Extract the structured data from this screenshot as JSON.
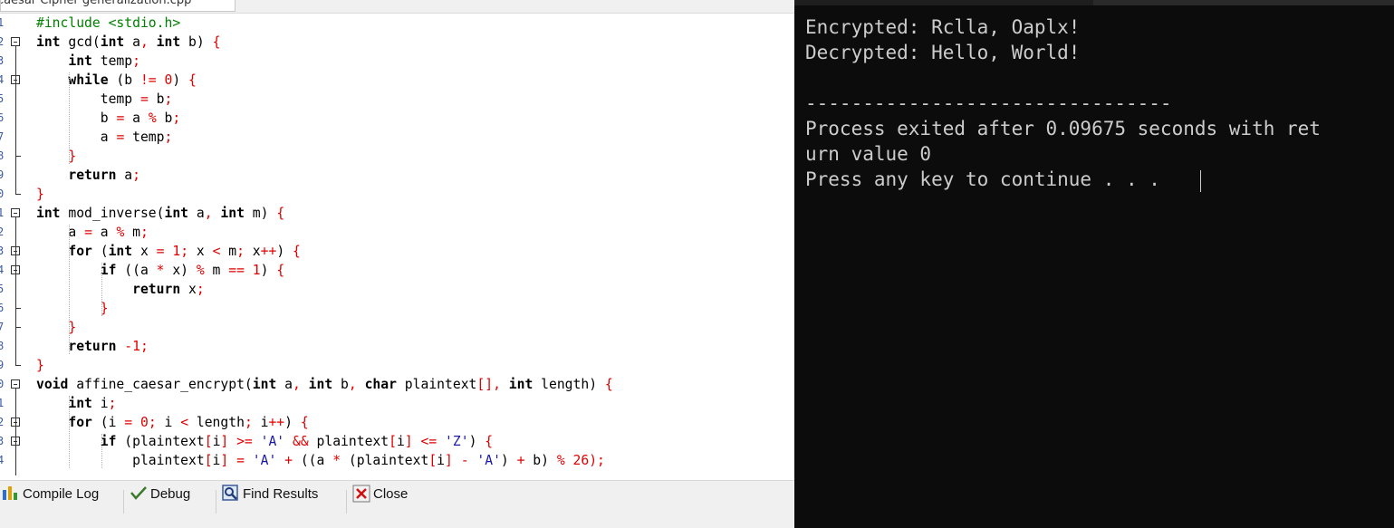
{
  "editor": {
    "tab_title": "Caesar Cipher generalization.cpp",
    "lines": [
      [
        {
          "t": "#include <stdio.h>",
          "c": "pp"
        }
      ],
      [
        {
          "t": "int",
          "c": "kw"
        },
        {
          "t": " gcd("
        },
        {
          "t": "int",
          "c": "kw"
        },
        {
          "t": " a"
        },
        {
          "t": ",",
          "c": "op"
        },
        {
          "t": " "
        },
        {
          "t": "int",
          "c": "kw"
        },
        {
          "t": " b) "
        },
        {
          "t": "{",
          "c": "op"
        }
      ],
      [
        {
          "t": "    "
        },
        {
          "t": "int",
          "c": "kw"
        },
        {
          "t": " temp"
        },
        {
          "t": ";",
          "c": "op"
        }
      ],
      [
        {
          "t": "    "
        },
        {
          "t": "while",
          "c": "kw"
        },
        {
          "t": " (b "
        },
        {
          "t": "!=",
          "c": "op"
        },
        {
          "t": " "
        },
        {
          "t": "0",
          "c": "num"
        },
        {
          "t": ") "
        },
        {
          "t": "{",
          "c": "op"
        }
      ],
      [
        {
          "t": "        temp "
        },
        {
          "t": "=",
          "c": "op"
        },
        {
          "t": " b"
        },
        {
          "t": ";",
          "c": "op"
        }
      ],
      [
        {
          "t": "        b "
        },
        {
          "t": "=",
          "c": "op"
        },
        {
          "t": " a "
        },
        {
          "t": "%",
          "c": "op"
        },
        {
          "t": " b"
        },
        {
          "t": ";",
          "c": "op"
        }
      ],
      [
        {
          "t": "        a "
        },
        {
          "t": "=",
          "c": "op"
        },
        {
          "t": " temp"
        },
        {
          "t": ";",
          "c": "op"
        }
      ],
      [
        {
          "t": "    "
        },
        {
          "t": "}",
          "c": "op"
        }
      ],
      [
        {
          "t": "    "
        },
        {
          "t": "return",
          "c": "kw"
        },
        {
          "t": " a"
        },
        {
          "t": ";",
          "c": "op"
        }
      ],
      [
        {
          "t": "}",
          "c": "op"
        }
      ],
      [
        {
          "t": "int",
          "c": "kw"
        },
        {
          "t": " mod_inverse("
        },
        {
          "t": "int",
          "c": "kw"
        },
        {
          "t": " a"
        },
        {
          "t": ",",
          "c": "op"
        },
        {
          "t": " "
        },
        {
          "t": "int",
          "c": "kw"
        },
        {
          "t": " m) "
        },
        {
          "t": "{",
          "c": "op"
        }
      ],
      [
        {
          "t": "    a "
        },
        {
          "t": "=",
          "c": "op"
        },
        {
          "t": " a "
        },
        {
          "t": "%",
          "c": "op"
        },
        {
          "t": " m"
        },
        {
          "t": ";",
          "c": "op"
        }
      ],
      [
        {
          "t": "    "
        },
        {
          "t": "for",
          "c": "kw"
        },
        {
          "t": " ("
        },
        {
          "t": "int",
          "c": "kw"
        },
        {
          "t": " x "
        },
        {
          "t": "=",
          "c": "op"
        },
        {
          "t": " "
        },
        {
          "t": "1",
          "c": "num"
        },
        {
          "t": ";",
          "c": "op"
        },
        {
          "t": " x "
        },
        {
          "t": "<",
          "c": "op"
        },
        {
          "t": " m"
        },
        {
          "t": ";",
          "c": "op"
        },
        {
          "t": " x"
        },
        {
          "t": "++",
          "c": "op"
        },
        {
          "t": ") "
        },
        {
          "t": "{",
          "c": "op"
        }
      ],
      [
        {
          "t": "        "
        },
        {
          "t": "if",
          "c": "kw"
        },
        {
          "t": " ((a "
        },
        {
          "t": "*",
          "c": "op"
        },
        {
          "t": " x) "
        },
        {
          "t": "%",
          "c": "op"
        },
        {
          "t": " m "
        },
        {
          "t": "==",
          "c": "op"
        },
        {
          "t": " "
        },
        {
          "t": "1",
          "c": "num"
        },
        {
          "t": ") "
        },
        {
          "t": "{",
          "c": "op"
        }
      ],
      [
        {
          "t": "            "
        },
        {
          "t": "return",
          "c": "kw"
        },
        {
          "t": " x"
        },
        {
          "t": ";",
          "c": "op"
        }
      ],
      [
        {
          "t": "        "
        },
        {
          "t": "}",
          "c": "op"
        }
      ],
      [
        {
          "t": "    "
        },
        {
          "t": "}",
          "c": "op"
        }
      ],
      [
        {
          "t": "    "
        },
        {
          "t": "return",
          "c": "kw"
        },
        {
          "t": " "
        },
        {
          "t": "-1",
          "c": "num"
        },
        {
          "t": ";",
          "c": "op"
        }
      ],
      [
        {
          "t": "}",
          "c": "op"
        }
      ],
      [
        {
          "t": "void",
          "c": "kw"
        },
        {
          "t": " affine_caesar_encrypt("
        },
        {
          "t": "int",
          "c": "kw"
        },
        {
          "t": " a"
        },
        {
          "t": ",",
          "c": "op"
        },
        {
          "t": " "
        },
        {
          "t": "int",
          "c": "kw"
        },
        {
          "t": " b"
        },
        {
          "t": ",",
          "c": "op"
        },
        {
          "t": " "
        },
        {
          "t": "char",
          "c": "kw"
        },
        {
          "t": " plaintext"
        },
        {
          "t": "[]",
          "c": "op"
        },
        {
          "t": ",",
          "c": "op"
        },
        {
          "t": " "
        },
        {
          "t": "int",
          "c": "kw"
        },
        {
          "t": " length) "
        },
        {
          "t": "{",
          "c": "op"
        }
      ],
      [
        {
          "t": "    "
        },
        {
          "t": "int",
          "c": "kw"
        },
        {
          "t": " i"
        },
        {
          "t": ";",
          "c": "op"
        }
      ],
      [
        {
          "t": "    "
        },
        {
          "t": "for",
          "c": "kw"
        },
        {
          "t": " (i "
        },
        {
          "t": "=",
          "c": "op"
        },
        {
          "t": " "
        },
        {
          "t": "0",
          "c": "num"
        },
        {
          "t": ";",
          "c": "op"
        },
        {
          "t": " i "
        },
        {
          "t": "<",
          "c": "op"
        },
        {
          "t": " length"
        },
        {
          "t": ";",
          "c": "op"
        },
        {
          "t": " i"
        },
        {
          "t": "++",
          "c": "op"
        },
        {
          "t": ") "
        },
        {
          "t": "{",
          "c": "op"
        }
      ],
      [
        {
          "t": "        "
        },
        {
          "t": "if",
          "c": "kw"
        },
        {
          "t": " (plaintext"
        },
        {
          "t": "[",
          "c": "op"
        },
        {
          "t": "i"
        },
        {
          "t": "]",
          "c": "op"
        },
        {
          "t": " "
        },
        {
          "t": ">=",
          "c": "op"
        },
        {
          "t": " "
        },
        {
          "t": "'A'",
          "c": "str"
        },
        {
          "t": " "
        },
        {
          "t": "&&",
          "c": "op"
        },
        {
          "t": " plaintext"
        },
        {
          "t": "[",
          "c": "op"
        },
        {
          "t": "i"
        },
        {
          "t": "]",
          "c": "op"
        },
        {
          "t": " "
        },
        {
          "t": "<=",
          "c": "op"
        },
        {
          "t": " "
        },
        {
          "t": "'Z'",
          "c": "str"
        },
        {
          "t": ") "
        },
        {
          "t": "{",
          "c": "op"
        }
      ],
      [
        {
          "t": "            plaintext"
        },
        {
          "t": "[",
          "c": "op"
        },
        {
          "t": "i"
        },
        {
          "t": "]",
          "c": "op"
        },
        {
          "t": " "
        },
        {
          "t": "=",
          "c": "op"
        },
        {
          "t": " "
        },
        {
          "t": "'A'",
          "c": "str"
        },
        {
          "t": " "
        },
        {
          "t": "+",
          "c": "op"
        },
        {
          "t": " ((a "
        },
        {
          "t": "*",
          "c": "op"
        },
        {
          "t": " (plaintext"
        },
        {
          "t": "[",
          "c": "op"
        },
        {
          "t": "i"
        },
        {
          "t": "]",
          "c": "op"
        },
        {
          "t": " "
        },
        {
          "t": "-",
          "c": "op"
        },
        {
          "t": " "
        },
        {
          "t": "'A'",
          "c": "str"
        },
        {
          "t": ") "
        },
        {
          "t": "+",
          "c": "op"
        },
        {
          "t": " b) "
        },
        {
          "t": "%",
          "c": "op"
        },
        {
          "t": " "
        },
        {
          "t": "26",
          "c": "num"
        },
        {
          "t": ");",
          "c": "op"
        }
      ]
    ]
  },
  "bottom_tabs": {
    "compile_log": "Compile Log",
    "debug": "Debug",
    "find_results": "Find Results",
    "close": "Close"
  },
  "console": {
    "lines": [
      "Encrypted: Rclla, Oaplx!",
      "Decrypted: Hello, World!",
      "",
      "--------------------------------",
      "Process exited after 0.09675 seconds with ret",
      "urn value 0",
      "Press any key to continue . . . "
    ]
  },
  "colors": {
    "keyword": "#000000",
    "operator": "#e00000",
    "preprocessor": "#008000",
    "console_bg": "#0c0c0c",
    "console_text": "#cccccc"
  }
}
